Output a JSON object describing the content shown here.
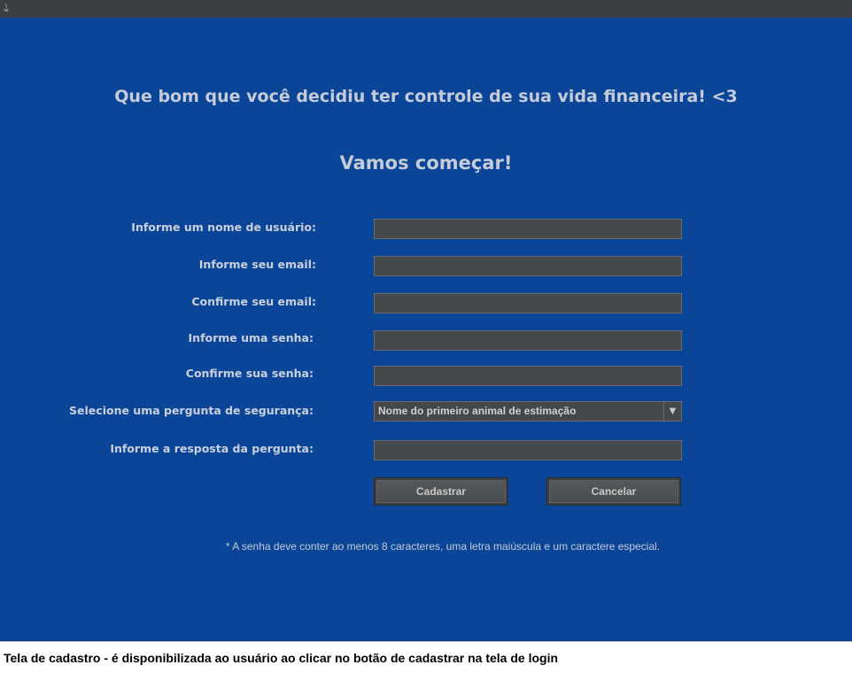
{
  "window": {
    "heading": "Que bom que você decidiu ter controle de sua vida financeira! <3",
    "subheading": "Vamos começar!"
  },
  "form": {
    "username_label": "Informe um nome de usuário:",
    "email_label": "Informe seu email:",
    "confirm_email_label": "Confirme seu email:",
    "password_label": "Informe uma senha:",
    "confirm_password_label": "Confirme sua senha:",
    "security_question_label": "Selecione uma pergunta de segurança:",
    "security_question_value": "Nome do primeiro animal de estimação",
    "security_answer_label": "Informe a resposta da pergunta:",
    "fields": {
      "username": "",
      "email": "",
      "confirm_email": "",
      "password": "",
      "confirm_password": "",
      "security_answer": ""
    }
  },
  "buttons": {
    "register": "Cadastrar",
    "cancel": "Cancelar"
  },
  "password_note": "* A senha deve conter ao menos 8 caracteres, uma letra maiúscula e um caractere especial.",
  "caption": "Tela de cadastro - é disponibilizada ao usuário ao clicar no botão de cadastrar na tela de login",
  "icons": {
    "app": "java-app-icon",
    "dropdown": "triangle-down-icon"
  },
  "colors": {
    "window_background": "#0a4598",
    "title_bar": "#3c3f41",
    "field_background": "#45484a",
    "text": "#c5ccd8"
  }
}
